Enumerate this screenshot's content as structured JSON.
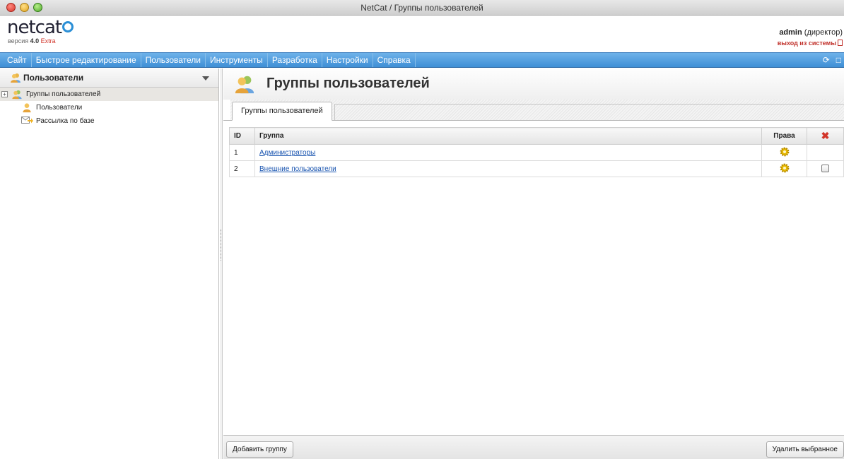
{
  "window": {
    "title": "NetCat / Группы пользователей"
  },
  "header": {
    "logo": "netcat",
    "version_prefix": "версия",
    "version_number": "4.0",
    "version_edition": "Extra",
    "user_name": "admin",
    "user_role": "(директор)",
    "logout_label": "выход из системы"
  },
  "menu": {
    "items": [
      "Сайт",
      "Быстрое редактирование",
      "Пользователи",
      "Инструменты",
      "Разработка",
      "Настройки",
      "Справка"
    ]
  },
  "sidebar": {
    "title": "Пользователи",
    "items": [
      {
        "label": "Группы пользователей",
        "selected": true
      },
      {
        "label": "Пользователи"
      },
      {
        "label": "Рассылка по базе"
      }
    ]
  },
  "main": {
    "title": "Группы пользователей",
    "tab_label": "Группы пользователей",
    "table": {
      "headers": {
        "id": "ID",
        "group": "Группа",
        "rights": "Права"
      },
      "rows": [
        {
          "id": "1",
          "name": "Администраторы",
          "has_checkbox": false
        },
        {
          "id": "2",
          "name": "Внешние пользователи",
          "has_checkbox": true
        }
      ]
    },
    "buttons": {
      "add_group": "Добавить группу",
      "delete_selected": "Удалить выбранное"
    }
  },
  "colors": {
    "menu_bar": "#3f8fd6",
    "link": "#1a55b0",
    "accent_red": "#d2352a",
    "gear": "#e6b800"
  }
}
